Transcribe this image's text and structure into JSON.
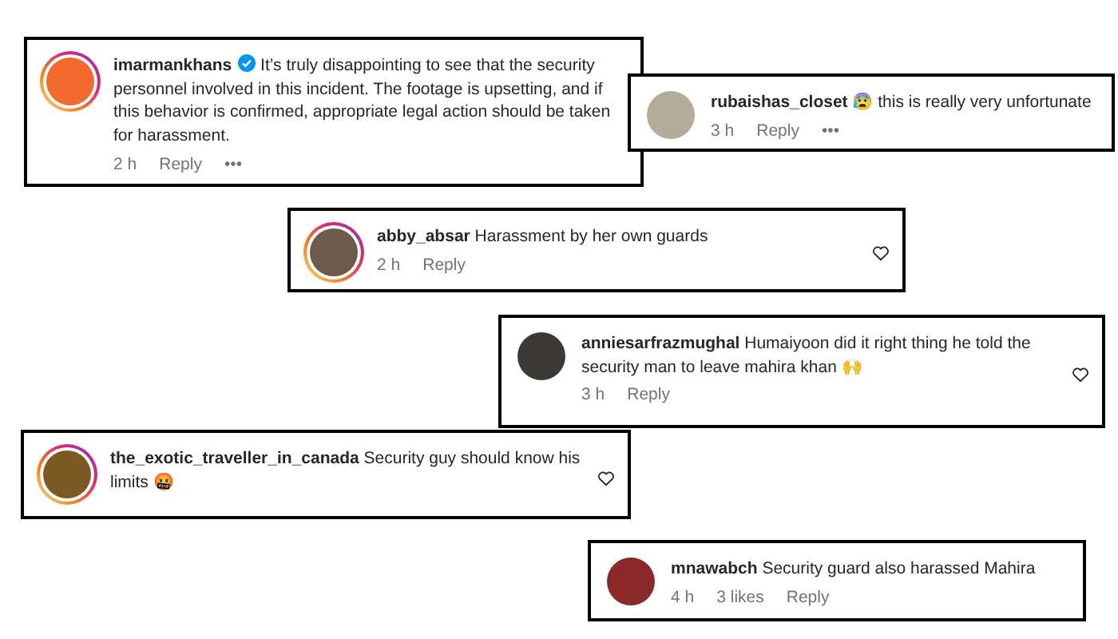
{
  "comments": [
    {
      "username": "imarmankhans",
      "verified": true,
      "text": "It’s truly disappointing to see that the security personnel involved in this incident. The footage is upsetting, and if this behavior is confirmed, appropriate legal action should be taken for harassment.",
      "story_ring": true,
      "avatar": {
        "color": "#f26a2e"
      },
      "footer": [
        "2 h",
        "Reply",
        "•••"
      ],
      "like_button": false
    },
    {
      "username": "rubaishas_closet",
      "verified": false,
      "text": "😰 this is really very unfortunate",
      "story_ring": false,
      "avatar": {
        "color": "#b3ad98"
      },
      "footer": [
        "3 h",
        "Reply",
        "•••"
      ],
      "like_button": false
    },
    {
      "username": "abby_absar",
      "verified": false,
      "text": "Harassment by her own guards",
      "story_ring": true,
      "avatar": {
        "color": "#6e5a48"
      },
      "footer": [
        "2 h",
        "Reply"
      ],
      "like_button": true
    },
    {
      "username": "anniesarfrazmughal",
      "verified": false,
      "text": "Humaiyoon did it right thing he told the security man to leave mahira khan 🙌",
      "story_ring": false,
      "avatar": {
        "color": "#3c3a36"
      },
      "footer": [
        "3 h",
        "Reply"
      ],
      "like_button": true
    },
    {
      "username": "the_exotic_traveller_in_canada",
      "verified": false,
      "text": "Security guy should know his limits 🤬",
      "story_ring": true,
      "avatar": {
        "color": "#7a5a22"
      },
      "like_button": true
    },
    {
      "username": "mnawabch",
      "verified": false,
      "text": "Security guard also harassed Mahira",
      "story_ring": false,
      "avatar": {
        "color": "#8a2a2a"
      },
      "footer": [
        "4 h",
        "3 likes",
        "Reply"
      ],
      "like_button": false
    }
  ]
}
